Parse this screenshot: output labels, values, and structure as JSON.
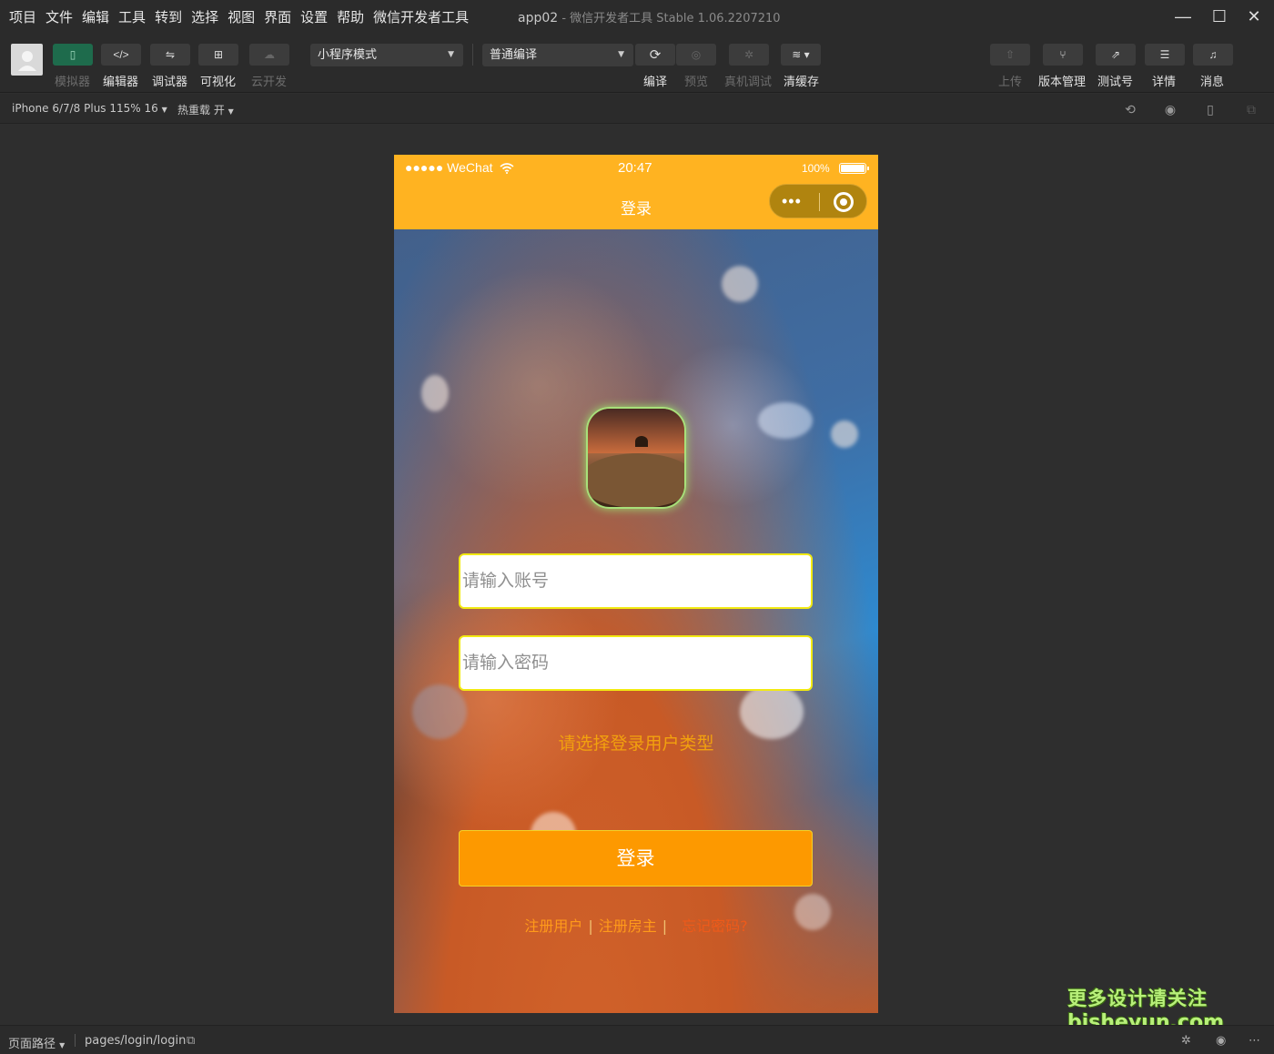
{
  "menu": [
    "项目",
    "文件",
    "编辑",
    "工具",
    "转到",
    "选择",
    "视图",
    "界面",
    "设置",
    "帮助",
    "微信开发者工具"
  ],
  "window": {
    "app_name": "app02",
    "subtitle": "微信开发者工具 Stable 1.06.2207210",
    "minimize": "—",
    "maximize": "☐",
    "close": "✕"
  },
  "toolbar": {
    "simulator": "模拟器",
    "editor": "编辑器",
    "debugger": "调试器",
    "visual": "可视化",
    "cloud": "云开发",
    "mode_select": "小程序模式",
    "compile_select": "普通编译",
    "compile": "编译",
    "preview": "预览",
    "real_debug": "真机调试",
    "clear_cache": "清缓存",
    "upload": "上传",
    "version": "版本管理",
    "test_account": "测试号",
    "details": "详情",
    "messages": "消息"
  },
  "subbar": {
    "device": "iPhone 6/7/8 Plus 115% 16",
    "hot_reload": "热重载 开"
  },
  "phone": {
    "carrier": "●●●●● WeChat",
    "time": "20:47",
    "battery": "100%",
    "nav_title": "登录",
    "capsule_dots": "•••",
    "account_placeholder": "请输入账号",
    "password_placeholder": "请输入密码",
    "user_type": "请选择登录用户类型",
    "login_button": "登录",
    "register_user": "注册用户",
    "register_landlord": "注册房主",
    "forgot": "忘记密码?",
    "separator": "|"
  },
  "bottombar": {
    "page_path_label": "页面路径",
    "page_path": "pages/login/login"
  },
  "watermark": {
    "line1": "更多设计请关注",
    "line2": "bisheyun.com"
  },
  "colors": {
    "nav_bg": "#ffb321",
    "login_btn": "#fd9900",
    "input_border": "#f2ea12",
    "link_orange": "#ff9a1a"
  }
}
